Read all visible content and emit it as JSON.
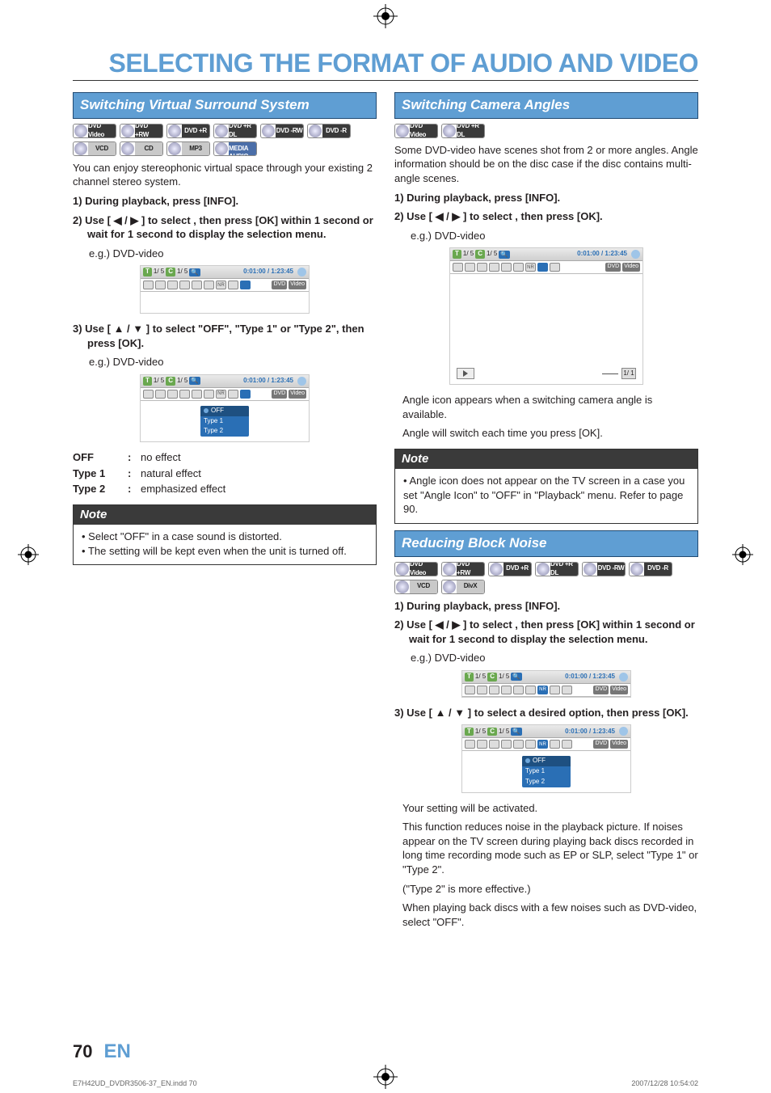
{
  "page": {
    "title": "SELECTING THE FORMAT OF AUDIO AND VIDEO",
    "number": "70",
    "lang_code": "EN",
    "footer_file": "E7H42UD_DVDR3506-37_EN.indd   70",
    "footer_date": "2007/12/28   10:54:02"
  },
  "left": {
    "section_title": "Switching Virtual Surround System",
    "discs_row1": [
      "DVD Video",
      "DVD +RW",
      "DVD +R",
      "DVD +R DL",
      "DVD -RW",
      "DVD -R"
    ],
    "discs_row2": [
      "VCD",
      "CD",
      "MP3",
      "WINDOWS MEDIA AUDIO"
    ],
    "intro": "You can enjoy stereophonic virtual space through your existing 2 channel stereo system.",
    "step1": "1) During playback, press [INFO].",
    "step2": "2) Use [ ◀ / ▶ ] to select       , then press [OK] within 1 second or wait for 1 second to display the selection menu.",
    "eg": "e.g.) DVD-video",
    "osd": {
      "t": "T",
      "c": "C",
      "tc1": "1/  5",
      "tc2": "1/  5",
      "time": "0:01:00 / 1:23:45",
      "icons": [
        "",
        "",
        "",
        "",
        "",
        "",
        "NR",
        "",
        ""
      ],
      "dvd": "DVD",
      "video": "Video"
    },
    "step3": "3) Use [ ▲ / ▼ ] to select \"OFF\", \"Type 1\" or \"Type 2\", then press [OK].",
    "menu": {
      "opt1": "OFF",
      "opt2": "Type 1",
      "opt3": "Type 2"
    },
    "defs": {
      "off_term": "OFF",
      "off_desc": "no effect",
      "t1_term": "Type 1",
      "t1_desc": "natural effect",
      "t2_term": "Type 2",
      "t2_desc": "emphasized effect",
      "colon": ":"
    },
    "note_head": "Note",
    "note1": "Select \"OFF\" in a case sound is distorted.",
    "note2": "The setting will be kept even when the unit is turned off."
  },
  "right": {
    "cam": {
      "section_title": "Switching Camera Angles",
      "discs": [
        "DVD Video",
        "DVD +R DL"
      ],
      "intro": "Some DVD-video have scenes shot from 2 or more angles. Angle information should be on the disc case if the disc contains multi-angle scenes.",
      "step1": "1) During playback, press [INFO].",
      "step2": "2) Use [ ◀ / ▶ ] to select       , then press [OK].",
      "eg": "e.g.) DVD-video",
      "angle_line": "Angle icon appears when a switching camera angle is available.",
      "angle_line2": "Angle will switch each time you press [OK].",
      "note_head": "Note",
      "note1": "Angle icon does not appear on the TV screen in a case you set \"Angle Icon\" to \"OFF\" in \"Playback\" menu. Refer to page 90."
    },
    "noise": {
      "section_title": "Reducing Block Noise",
      "discs_row1": [
        "DVD Video",
        "DVD +RW",
        "DVD +R",
        "DVD +R DL",
        "DVD -RW",
        "DVD -R"
      ],
      "discs_row2": [
        "VCD",
        "DivX"
      ],
      "step1": "1) During playback, press [INFO].",
      "step2": "2) Use [ ◀ / ▶ ] to select       , then press [OK] within 1 second or wait for 1 second to display the selection menu.",
      "eg": "e.g.) DVD-video",
      "step3": "3) Use [ ▲ / ▼ ] to select a desired option, then press [OK].",
      "menu": {
        "opt1": "OFF",
        "opt2": "Type 1",
        "opt3": "Type 2"
      },
      "act": "Your setting will be activated.",
      "body1": "This function reduces noise in the playback picture. If noises appear on the TV screen during playing back discs recorded in long time recording mode such as EP or SLP, select \"Type 1\" or \"Type 2\".",
      "body2": "(\"Type 2\" is more effective.)",
      "body3": "When playing back discs with a few noises such as DVD-video, select \"OFF\"."
    }
  },
  "icons": {
    "nr_label": "NR",
    "angle_label": "1/ 1"
  }
}
